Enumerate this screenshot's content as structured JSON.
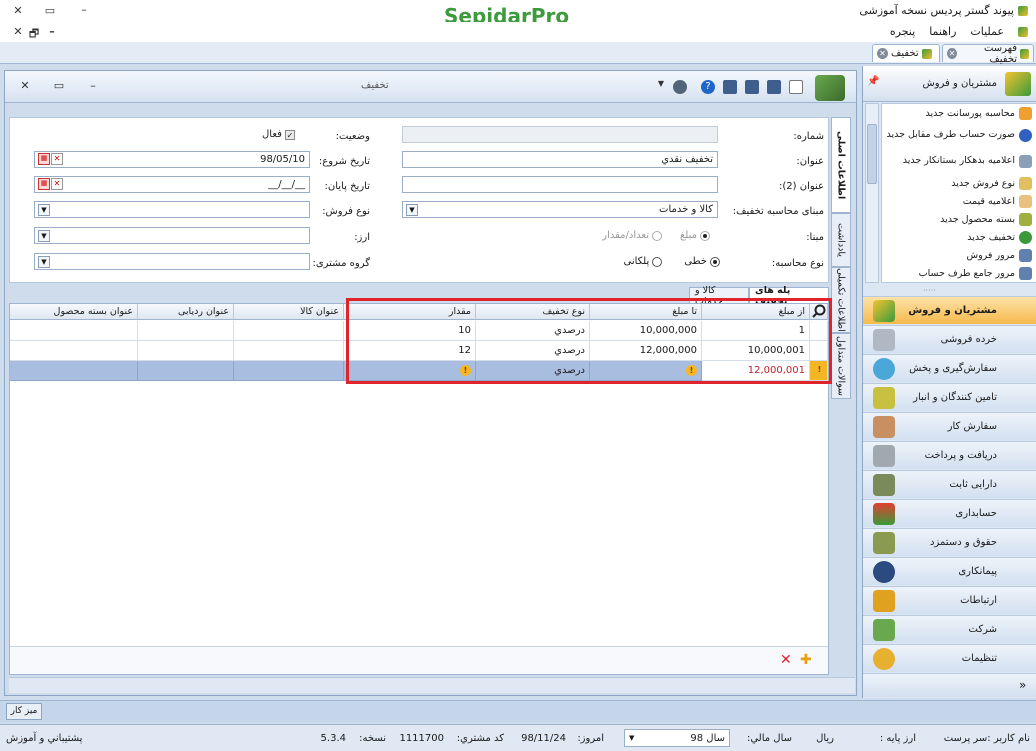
{
  "titlebar": {
    "app_title": "پیوند گستر پردیس نسخه آموزشی",
    "logo": "SepidarPro",
    "min": "–",
    "restore": "▭",
    "close": "✕"
  },
  "menubar": {
    "items": [
      "عملیات",
      "راهنما",
      "پنجره"
    ],
    "close": "✕",
    "restore": "🗗",
    "min": "–"
  },
  "doc_tabs": [
    {
      "label": "فهرست تخفیف"
    },
    {
      "label": "تخفیف"
    }
  ],
  "form": {
    "window_title": "تخفیف",
    "labels": {
      "number": "شماره:",
      "title": "عنوان:",
      "title2": "عنوان (2):",
      "calc_basis": "مبنای محاسبه تخفیف:",
      "basis": "مبنا:",
      "calc_type": "نوع محاسبه:",
      "status": "وضعیت:",
      "start_date": "تاریخ شروع:",
      "end_date": "تاریخ پایان:",
      "sale_type": "نوع فروش:",
      "currency": "ارز:",
      "customer_group": "گروه مشتری:"
    },
    "values": {
      "number": "",
      "title": "تخفیف نقدي",
      "title2": "",
      "calc_basis": "کالا و خدمات",
      "start_date": "98/05/10",
      "end_date": "__/__/__",
      "sale_type": "",
      "currency": "",
      "customer_group": ""
    },
    "status_checkbox": "فعال",
    "basis_options": {
      "amount": "مبلغ",
      "count": "تعداد/مقدار"
    },
    "calc_options": {
      "linear": "خطی",
      "stepwise": "پلکانی"
    },
    "vertical_tabs": [
      "اطلاعات اصلی",
      "یادداشت",
      "اطلاعات تکمیلی",
      "سوالات متداول"
    ]
  },
  "grid": {
    "tabs": [
      "پله های تخفیف",
      "کالا و خدمات"
    ],
    "headers": {
      "from": "از مبلغ",
      "to": "تا مبلغ",
      "type": "نوع تخفیف",
      "qty": "مقدار",
      "item": "عنوان کالا",
      "tracking": "عنوان ردیابی",
      "bundle": "عنوان بسته محصول"
    },
    "rows": [
      {
        "from": "1",
        "to": "10,000,000",
        "type": "درصدي",
        "qty": "10"
      },
      {
        "from": "10,000,001",
        "to": "12,000,000",
        "type": "درصدي",
        "qty": "12"
      },
      {
        "from": "12,000,001",
        "to": "",
        "type": "درصدي",
        "qty": ""
      }
    ],
    "footer_delete": "✕",
    "footer_add": "✚"
  },
  "right_panel": {
    "title": "مشتریان و فروش",
    "pin": "📌",
    "list": [
      "محاسبه پورسانت جدید",
      "صورت حساب طرف مقابل جدید",
      "اعلامیه بدهکار بستانکار جدید",
      "نوع فروش جدید",
      "اعلامیه قیمت",
      "بسته محصول جدید",
      "تخفیف جدید",
      "مرور فروش",
      "مرور جامع طرف حساب"
    ],
    "nav": [
      "مشتریان و فروش",
      "خرده فروشی",
      "سفارش‌گیری و پخش",
      "تامین کنندگان و انبار",
      "سفارش کار",
      "دریافت و پرداخت",
      "دارایی ثابت",
      "حسابداری",
      "حقوق و دستمزد",
      "پیمانکاری",
      "ارتباطات",
      "شرکت",
      "تنظیمات"
    ],
    "more": "»"
  },
  "taskbar": {
    "desktop": "میز کار"
  },
  "statusbar": {
    "user": "نام کاربر :سر پرست",
    "base_currency_label": "ارز پایه :",
    "base_currency": "ریال",
    "fiscal_year_label": "سال مالي:",
    "fiscal_year": "سال 98",
    "today_label": "امروز:",
    "today": "98/11/24",
    "customer_code_label": "کد مشتري:",
    "customer_code": "1111700",
    "version_label": "نسخه:",
    "version": "5.3.4",
    "support": "پشتیباني و آموزش"
  },
  "colors": {
    "accent": "#f6b94c",
    "highlight": "#e0242b",
    "selected_row": "#a9bde0"
  }
}
